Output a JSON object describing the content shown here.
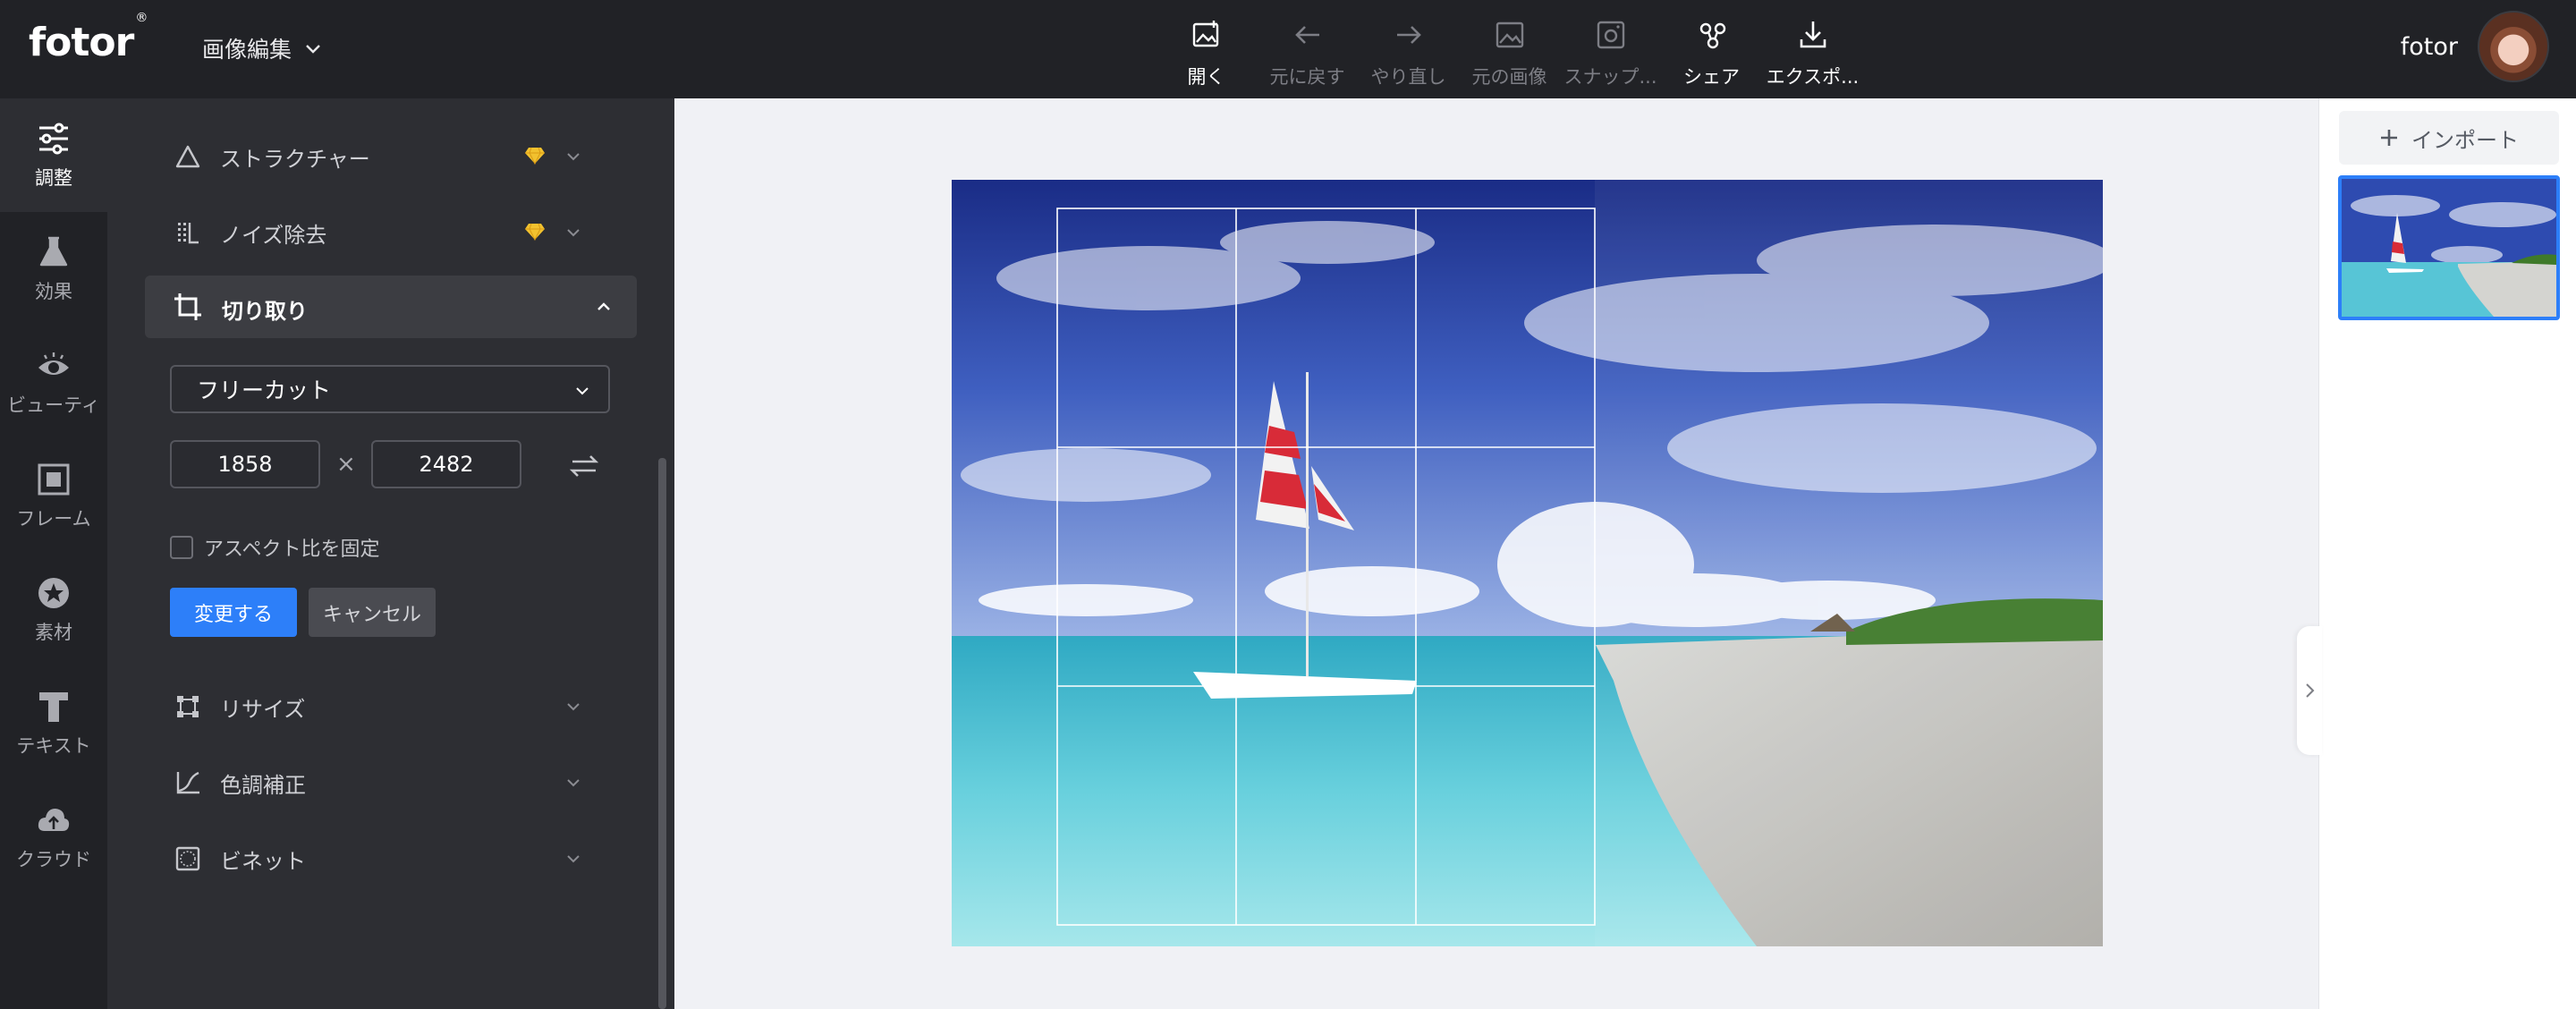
{
  "app": {
    "logo": "fotor",
    "logo_mark": "®",
    "mode": "画像編集"
  },
  "toolbar": [
    {
      "label": "開く",
      "icon": "open-image-icon",
      "enabled": true
    },
    {
      "label": "元に戻す",
      "icon": "undo-arrow-icon",
      "enabled": false
    },
    {
      "label": "やり直し",
      "icon": "redo-arrow-icon",
      "enabled": false
    },
    {
      "label": "元の画像",
      "icon": "original-image-icon",
      "enabled": false
    },
    {
      "label": "スナップ...",
      "icon": "snapshot-icon",
      "enabled": false
    },
    {
      "label": "シェア",
      "icon": "share-icon",
      "enabled": true
    },
    {
      "label": "エクスポ...",
      "icon": "download-icon",
      "enabled": true
    }
  ],
  "user": {
    "name": "fotor"
  },
  "sidebar": [
    {
      "label": "調整",
      "icon": "sliders-icon",
      "active": true
    },
    {
      "label": "効果",
      "icon": "flask-icon",
      "active": false
    },
    {
      "label": "ビューティ",
      "icon": "eye-icon",
      "active": false
    },
    {
      "label": "フレーム",
      "icon": "frame-icon",
      "active": false
    },
    {
      "label": "素材",
      "icon": "star-badge-icon",
      "active": false
    },
    {
      "label": "テキスト",
      "icon": "text-t-icon",
      "active": false
    },
    {
      "label": "クラウド",
      "icon": "cloud-upload-icon",
      "active": false
    }
  ],
  "panel": {
    "structure": {
      "label": "ストラクチャー",
      "premium": true
    },
    "denoise": {
      "label": "ノイズ除去",
      "premium": true
    },
    "crop": {
      "label": "切り取り",
      "ratio": "フリーカット",
      "width": "1858",
      "height": "2482",
      "times": "×",
      "lock_aspect": "アスペクト比を固定",
      "lock_aspect_checked": false,
      "apply": "変更する",
      "cancel": "キャンセル"
    },
    "resize": {
      "label": "リサイズ"
    },
    "color": {
      "label": "色調補正"
    },
    "vignette": {
      "label": "ビネット"
    }
  },
  "right": {
    "import_label": "インポート"
  },
  "colors": {
    "accent": "#2d7ff9",
    "dark_bg": "#212226",
    "panel_bg": "#2d2e33",
    "premium": "#f2c12e"
  }
}
